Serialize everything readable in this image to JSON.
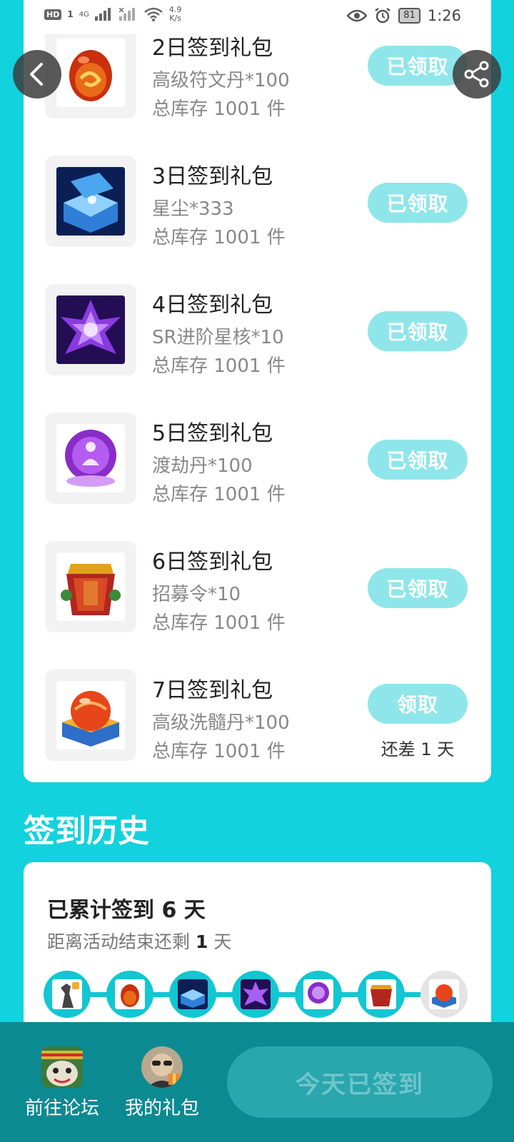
{
  "status": {
    "hd": "HD",
    "sim": "1",
    "network": "4G",
    "speed_value": "4.9",
    "speed_unit": "K/s",
    "battery": "81",
    "time": "1:26"
  },
  "gifts": [
    {
      "title": "2日签到礼包",
      "desc": "高级符文丹*100",
      "stock": "总库存 1001 件",
      "button": "已领取"
    },
    {
      "title": "3日签到礼包",
      "desc": "星尘*333",
      "stock": "总库存 1001 件",
      "button": "已领取"
    },
    {
      "title": "4日签到礼包",
      "desc": "SR进阶星核*10",
      "stock": "总库存 1001 件",
      "button": "已领取"
    },
    {
      "title": "5日签到礼包",
      "desc": "渡劫丹*100",
      "stock": "总库存 1001 件",
      "button": "已领取"
    },
    {
      "title": "6日签到礼包",
      "desc": "招募令*10",
      "stock": "总库存 1001 件",
      "button": "已领取"
    },
    {
      "title": "7日签到礼包",
      "desc": "高级洗髓丹*100",
      "stock": "总库存 1001 件",
      "button": "领取",
      "remain": "还差 1 天"
    }
  ],
  "history": {
    "title": "签到历史",
    "total_prefix": "已累计签到",
    "total_days": "6",
    "total_suffix": "天",
    "remain_prefix": "距离活动结束还剩",
    "remain_days": "1",
    "remain_suffix": "天"
  },
  "bottom": {
    "forum_label": "前往论坛",
    "gifts_label": "我的礼包",
    "signed_label": "今天已签到"
  },
  "colors": {
    "accent": "#12d2dd",
    "button_disabled": "#8fe6ea",
    "bottom_bar": "#0c8a92"
  }
}
